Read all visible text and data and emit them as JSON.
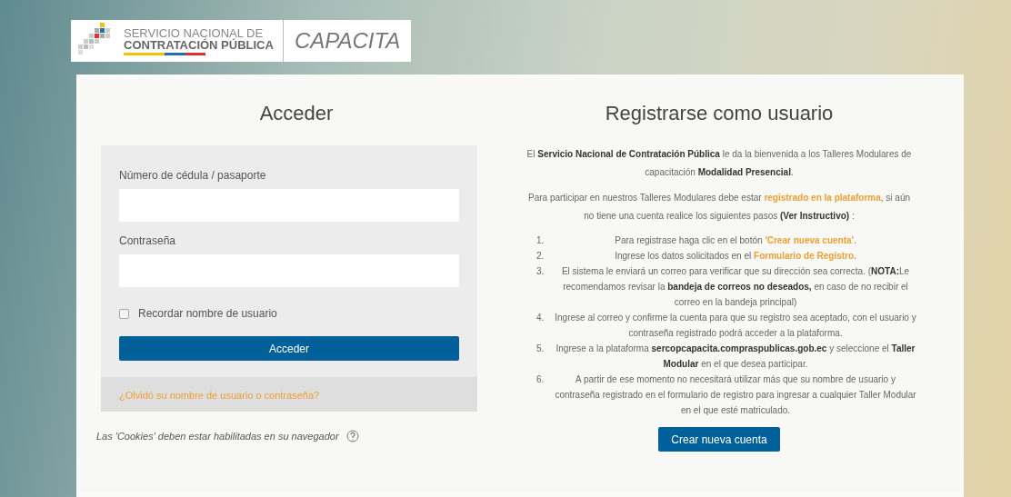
{
  "logo": {
    "agency_line_1": "SERVICIO NACIONAL DE",
    "agency_line_2": "CONTRATACIÓN PÚBLICA",
    "product": "CAPACITA"
  },
  "login": {
    "title": "Acceder",
    "fields": [
      {
        "label": "Número de cédula / pasaporte"
      },
      {
        "label": "Contraseña"
      }
    ],
    "remember": {
      "label": "Recordar nombre de usuario",
      "checked": false
    },
    "submit": "Acceder",
    "forgot": "¿Olvidó su nombre de usuario o contraseña?",
    "cookies_note": "Las 'Cookies' deben estar habilitadas en su navegador"
  },
  "register": {
    "title": "Registrarse como usuario",
    "paragraphs": [
      [
        {
          "kind": "plain",
          "text": "El "
        },
        {
          "kind": "bold",
          "text": "Servicio Nacional de Contratación Pública"
        },
        {
          "kind": "plain",
          "text": " le da la bienvenida a los Talleres Modulares de capacitación "
        },
        {
          "kind": "bold",
          "text": "Modalidad Presencial"
        },
        {
          "kind": "plain",
          "text": "."
        }
      ],
      [
        {
          "kind": "plain",
          "text": "Para participar en nuestros Talleres Modulares debe estar "
        },
        {
          "kind": "link",
          "text": "registrado en la plataforma"
        },
        {
          "kind": "plain",
          "text": ", si aún no tiene una cuenta realice los siguientes pasos "
        },
        {
          "kind": "bold",
          "text": "(Ver Instructivo)"
        },
        {
          "kind": "plain",
          "text": " :"
        }
      ]
    ],
    "steps": [
      {
        "number": "1.",
        "parts": [
          {
            "kind": "plain",
            "text": "Para registrase haga clic en el botón "
          },
          {
            "kind": "link",
            "text": "'Crear nueva cuenta'"
          },
          {
            "kind": "plain",
            "text": "."
          }
        ]
      },
      {
        "number": "2.",
        "parts": [
          {
            "kind": "plain",
            "text": "Ingrese los datos solicitados en el "
          },
          {
            "kind": "link",
            "text": "Formulario de Registro"
          },
          {
            "kind": "plain",
            "text": "."
          }
        ]
      },
      {
        "number": "3.",
        "parts": [
          {
            "kind": "plain",
            "text": "El sistema le enviará un correo para verificar que su dirección sea correcta. ("
          },
          {
            "kind": "bold",
            "text": "NOTA:"
          },
          {
            "kind": "plain",
            "text": "Le recomendamos revisar la "
          },
          {
            "kind": "bold",
            "text": "bandeja de correos no deseados,"
          },
          {
            "kind": "plain",
            "text": " en caso de no recibir el correo en la bandeja principal)"
          }
        ]
      },
      {
        "number": "4.",
        "parts": [
          {
            "kind": "plain",
            "text": "Ingrese al correo y confirme la cuenta para que su registro sea aceptado, con el usuario y contraseña registrado podrá acceder a la plataforma."
          }
        ]
      },
      {
        "number": "5.",
        "parts": [
          {
            "kind": "plain",
            "text": "Ingrese a la plataforma "
          },
          {
            "kind": "bold",
            "text": "sercopcapacita.compraspublicas.gob.ec"
          },
          {
            "kind": "plain",
            "text": " y seleccione el "
          },
          {
            "kind": "bold",
            "text": "Taller Modular"
          },
          {
            "kind": "plain",
            "text": " en el que desea participar."
          }
        ]
      },
      {
        "number": "6.",
        "parts": [
          {
            "kind": "plain",
            "text": "A partir de ese momento no necesitará utilizar más que su nombre de usuario y contraseña registrado en el formulario de registro para ingresar a cualquier Taller Modular en el que esté matriculado."
          }
        ]
      }
    ],
    "button": "Crear nueva cuenta"
  }
}
